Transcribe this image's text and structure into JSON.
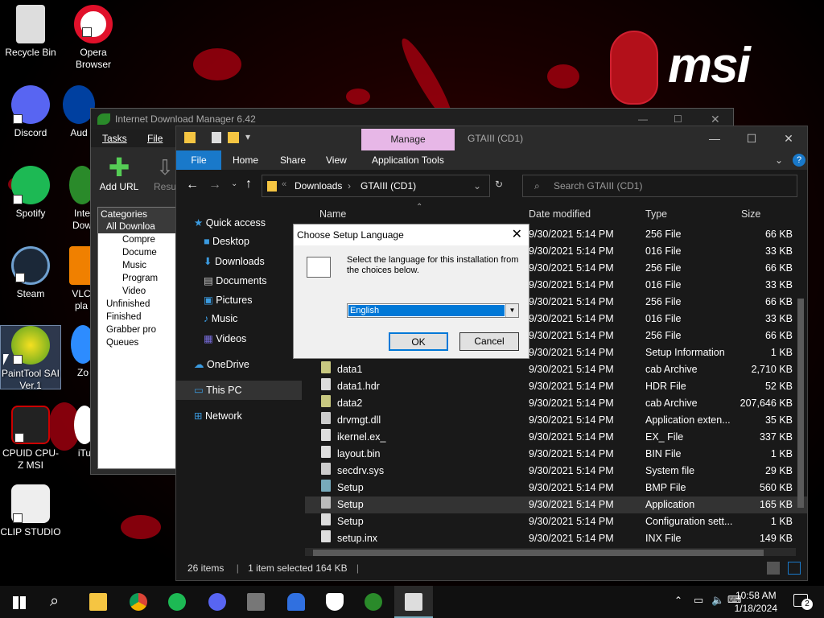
{
  "desktop": {
    "icons": [
      {
        "label": "Recycle Bin"
      },
      {
        "label": "Opera Browser"
      },
      {
        "label": "Discord"
      },
      {
        "label": "Aud"
      },
      {
        "label": "Spotify"
      },
      {
        "label": "Inte Dow"
      },
      {
        "label": "Steam"
      },
      {
        "label": "VLC pla"
      },
      {
        "label": "PaintTool SAI Ver.1"
      },
      {
        "label": "Zo"
      },
      {
        "label": "CPUID CPU-Z MSI"
      },
      {
        "label": "iTu"
      },
      {
        "label": "CLIP STUDIO"
      }
    ],
    "brand_text": "msi"
  },
  "idm": {
    "title": "Internet Download Manager 6.42",
    "menu": [
      "Tasks",
      "File"
    ],
    "tools": [
      "Add URL",
      "Resu"
    ],
    "categories_header": "Categories",
    "categories": [
      "All Downloa",
      "Compre",
      "Docume",
      "Music",
      "Program",
      "Video",
      "Unfinished",
      "Finished",
      "Grabber pro",
      "Queues"
    ]
  },
  "explorer": {
    "title_tab": "Manage",
    "folder_name": "GTAIII (CD1)",
    "ribbon": [
      "File",
      "Home",
      "Share",
      "View",
      "Application Tools"
    ],
    "breadcrumb": [
      "Downloads",
      "GTAIII (CD1)"
    ],
    "search_placeholder": "Search GTAIII (CD1)",
    "nav": [
      "Quick access",
      "Desktop",
      "Downloads",
      "Documents",
      "Pictures",
      "Music",
      "Videos",
      "OneDrive",
      "This PC",
      "Network"
    ],
    "columns": [
      "Name",
      "Date modified",
      "Type",
      "Size"
    ],
    "files": [
      {
        "name": "",
        "date": "9/30/2021 5:14 PM",
        "type": "256 File",
        "size": "66 KB"
      },
      {
        "name": "",
        "date": "9/30/2021 5:14 PM",
        "type": "016 File",
        "size": "33 KB"
      },
      {
        "name": "",
        "date": "9/30/2021 5:14 PM",
        "type": "256 File",
        "size": "66 KB"
      },
      {
        "name": "",
        "date": "9/30/2021 5:14 PM",
        "type": "016 File",
        "size": "33 KB"
      },
      {
        "name": "",
        "date": "9/30/2021 5:14 PM",
        "type": "256 File",
        "size": "66 KB"
      },
      {
        "name": "",
        "date": "9/30/2021 5:14 PM",
        "type": "016 File",
        "size": "33 KB"
      },
      {
        "name": "",
        "date": "9/30/2021 5:14 PM",
        "type": "256 File",
        "size": "66 KB"
      },
      {
        "name": "",
        "date": "9/30/2021 5:14 PM",
        "type": "Setup Information",
        "size": "1 KB"
      },
      {
        "name": "data1",
        "date": "9/30/2021 5:14 PM",
        "type": "cab Archive",
        "size": "2,710 KB"
      },
      {
        "name": "data1.hdr",
        "date": "9/30/2021 5:14 PM",
        "type": "HDR File",
        "size": "52 KB"
      },
      {
        "name": "data2",
        "date": "9/30/2021 5:14 PM",
        "type": "cab Archive",
        "size": "207,646 KB"
      },
      {
        "name": "drvmgt.dll",
        "date": "9/30/2021 5:14 PM",
        "type": "Application exten...",
        "size": "35 KB"
      },
      {
        "name": "ikernel.ex_",
        "date": "9/30/2021 5:14 PM",
        "type": "EX_ File",
        "size": "337 KB"
      },
      {
        "name": "layout.bin",
        "date": "9/30/2021 5:14 PM",
        "type": "BIN File",
        "size": "1 KB"
      },
      {
        "name": "secdrv.sys",
        "date": "9/30/2021 5:14 PM",
        "type": "System file",
        "size": "29 KB"
      },
      {
        "name": "Setup",
        "date": "9/30/2021 5:14 PM",
        "type": "BMP File",
        "size": "560 KB"
      },
      {
        "name": "Setup",
        "date": "9/30/2021 5:14 PM",
        "type": "Application",
        "size": "165 KB"
      },
      {
        "name": "Setup",
        "date": "9/30/2021 5:14 PM",
        "type": "Configuration sett...",
        "size": "1 KB"
      },
      {
        "name": "setup.inx",
        "date": "9/30/2021 5:14 PM",
        "type": "INX File",
        "size": "149 KB"
      }
    ],
    "status": {
      "items": "26 items",
      "selected": "1 item selected  164 KB"
    }
  },
  "dialog": {
    "title": "Choose Setup Language",
    "message": "Select the language for this installation from the choices below.",
    "selected_language": "English",
    "ok_label": "OK",
    "cancel_label": "Cancel"
  },
  "taskbar": {
    "time": "10:58 AM",
    "date": "1/18/2024",
    "notification_count": "2"
  }
}
